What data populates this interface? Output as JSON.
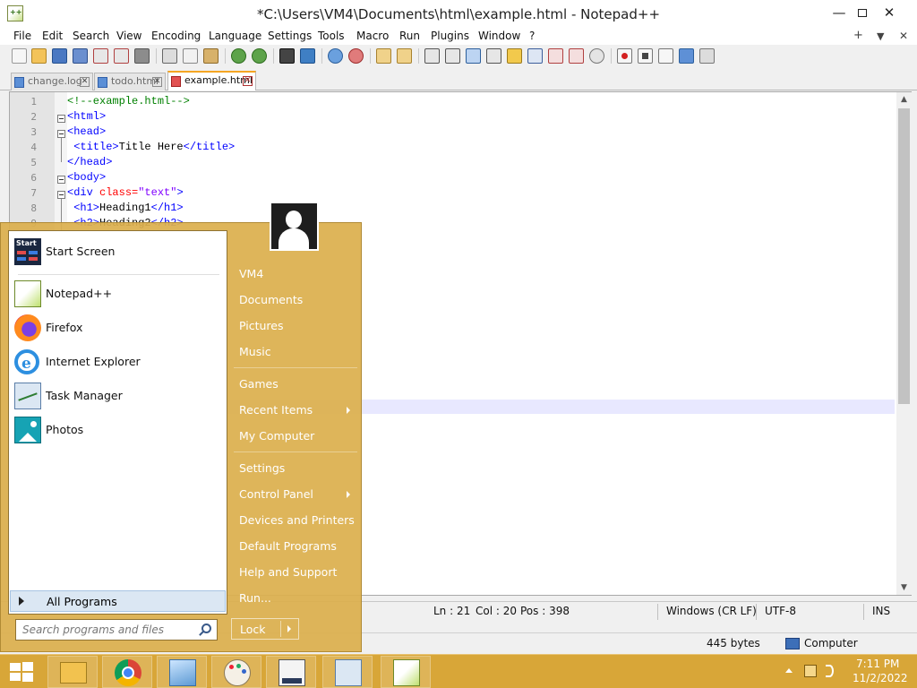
{
  "window": {
    "title": "*C:\\Users\\VM4\\Documents\\html\\example.html - Notepad++",
    "minimize": "—",
    "close": "✕"
  },
  "menu": [
    "File",
    "Edit",
    "Search",
    "View",
    "Encoding",
    "Language",
    "Settings",
    "Tools",
    "Macro",
    "Run",
    "Plugins",
    "Window",
    "?"
  ],
  "menu_extra": {
    "plus": "+",
    "down": "▼",
    "close": "✕"
  },
  "tabs": [
    {
      "label": "change.log",
      "active": false
    },
    {
      "label": "todo.html",
      "active": false
    },
    {
      "label": "example.html",
      "active": true
    }
  ],
  "editor": {
    "line_numbers": [
      "1",
      "2",
      "3",
      "4",
      "5",
      "6",
      "7",
      "8",
      "9"
    ],
    "lines": [
      {
        "cm": "<!--example.html-->"
      },
      {
        "tag": "<html>"
      },
      {
        "tag": "<head>"
      },
      {
        "tag": "<title>",
        "txt": "Title Here",
        "tag2": "</title>"
      },
      {
        "tag": "</head>"
      },
      {
        "tag": "<body>"
      },
      {
        "tag": "<div ",
        "attr": "class=",
        "val": "\"text\"",
        "tag2": ">"
      },
      {
        "tag": "<h1>",
        "txt": "Heading1",
        "tag2": "</h1>"
      },
      {
        "tag": "<h2>",
        "txt": "Heading2",
        "tag2": "</h2>"
      }
    ]
  },
  "status": {
    "ln": "Ln : 21",
    "col": "Col : 20",
    "pos": "Pos : 398",
    "eol": "Windows (CR LF)",
    "encoding": "UTF-8",
    "mode": "INS"
  },
  "explorer_status": {
    "size": "445 bytes",
    "location": "Computer"
  },
  "start_menu": {
    "programs": [
      "Start Screen",
      "Notepad++",
      "Firefox",
      "Internet Explorer",
      "Task Manager",
      "Photos"
    ],
    "start_icon_text": "Start",
    "all_programs": "All Programs",
    "search_placeholder": "Search programs and files",
    "right_items": [
      "VM4",
      "Documents",
      "Pictures",
      "Music",
      "Games",
      "Recent Items",
      "My Computer",
      "Settings",
      "Control Panel",
      "Devices and Printers",
      "Default Programs",
      "Help and Support",
      "Run..."
    ],
    "lock": "Lock"
  },
  "taskbar": {
    "apps": [
      "file-explorer",
      "chrome",
      "notepad",
      "paint",
      "start-screen-tool",
      "task-manager",
      "notepad-plus-plus"
    ],
    "time": "7:11 PM",
    "date": "11/2/2022"
  },
  "colors": {
    "accent": "#dcb55a",
    "taskbar": "#d8a638",
    "tag": "#0000ff",
    "comment": "#008000",
    "attribute": "#ff0000",
    "value": "#8000ff"
  }
}
